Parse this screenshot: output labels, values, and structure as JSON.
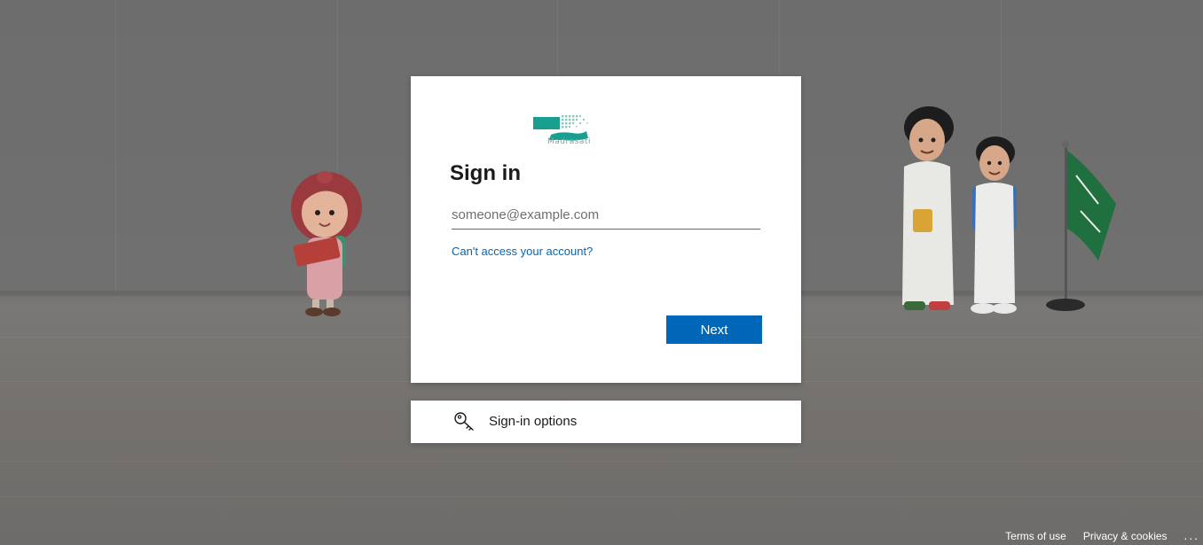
{
  "login": {
    "logo_text": "Madrasati",
    "title": "Sign in",
    "email_placeholder": "someone@example.com",
    "email_value": "",
    "help_link": "Can't access your account?",
    "next_label": "Next"
  },
  "sign_in_options": {
    "label": "Sign-in options",
    "icon": "key-icon"
  },
  "footer": {
    "terms": "Terms of use",
    "privacy": "Privacy & cookies",
    "more": "..."
  },
  "colors": {
    "accent": "#0067b8",
    "brand_teal": "#1a9e8f",
    "background": "#707070"
  }
}
